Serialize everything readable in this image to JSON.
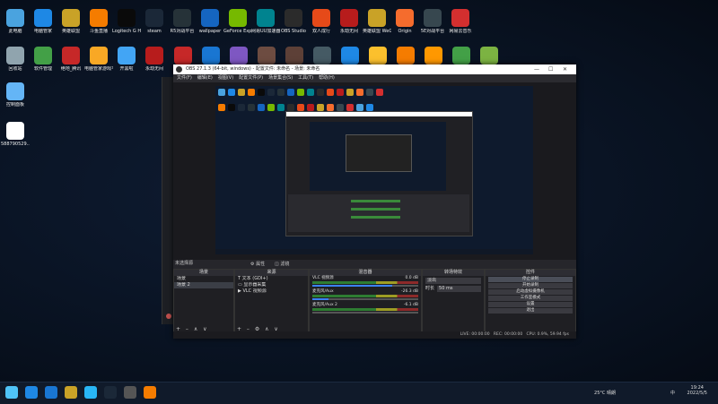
{
  "desktop": {
    "row1": [
      {
        "label": "此电脑",
        "color": "#4aa3df",
        "icon": "computer-icon"
      },
      {
        "label": "电脑管家",
        "color": "#1e88e5",
        "icon": "shield-icon"
      },
      {
        "label": "英雄联盟",
        "color": "#c9a227",
        "icon": "game-icon"
      },
      {
        "label": "斗鱼直播",
        "color": "#f57c00",
        "icon": "stream-icon"
      },
      {
        "label": "Logitech G HUB",
        "color": "#0a0a0a",
        "icon": "logitech-icon"
      },
      {
        "label": "steam",
        "color": "#1b2838",
        "icon": "steam-icon"
      },
      {
        "label": "R5对战平台",
        "color": "#263238",
        "icon": "platform-icon"
      },
      {
        "label": "wallpaper",
        "color": "#1565c0",
        "icon": "wallpaper-icon"
      },
      {
        "label": "GeForce Experience",
        "color": "#76b900",
        "icon": "nvidia-icon"
      },
      {
        "label": "网易UU加速器",
        "color": "#00838f",
        "icon": "accelerator-icon"
      },
      {
        "label": "OBS Studio",
        "color": "#2b2b2b",
        "icon": "obs-icon"
      },
      {
        "label": "双人成行",
        "color": "#e64a19",
        "icon": "game-icon"
      },
      {
        "label": "永劫无间",
        "color": "#b71c1c",
        "icon": "game-icon"
      },
      {
        "label": "英雄联盟 WeGame版",
        "color": "#c9a227",
        "icon": "game-icon"
      },
      {
        "label": "Origin",
        "color": "#f56c2d",
        "icon": "origin-icon"
      },
      {
        "label": "5E对战平台",
        "color": "#37474f",
        "icon": "platform-icon"
      },
      {
        "label": "网易云音乐",
        "color": "#d32f2f",
        "icon": "music-icon"
      }
    ],
    "row2": [
      {
        "label": "回收站",
        "color": "#90a4ae",
        "icon": "recycle-bin-icon"
      },
      {
        "label": "软件管理",
        "color": "#43a047",
        "icon": "apps-icon"
      },
      {
        "label": "绝地_腾讯",
        "color": "#c62828",
        "icon": "game-icon"
      },
      {
        "label": "电脑管家游戏平台",
        "color": "#f9a825",
        "icon": "game-icon"
      },
      {
        "label": "开黑啦",
        "color": "#42a5f5",
        "icon": "chat-icon"
      },
      {
        "label": "永劫无间",
        "color": "#b71c1c",
        "icon": "game-icon"
      }
    ],
    "row2_hidden_icons": [
      {
        "color": "#c62828"
      },
      {
        "color": "#1976d2"
      },
      {
        "color": "#7e57c2"
      },
      {
        "color": "#6d4c41"
      },
      {
        "color": "#5d4037"
      },
      {
        "color": "#455a64"
      },
      {
        "color": "#1e88e5"
      },
      {
        "color": "#fbc02d"
      },
      {
        "color": "#f57c00"
      },
      {
        "color": "#ff9800"
      },
      {
        "color": "#43a047"
      },
      {
        "color": "#7cb342"
      }
    ],
    "left_items": [
      {
        "label": "控制面板",
        "color": "#64b5f6",
        "icon": "control-panel-icon"
      },
      {
        "label": "588790529...",
        "color": "#ffffff",
        "icon": "user-icon"
      }
    ]
  },
  "obs": {
    "title": "OBS 27.1.3 (64-bit, windows) - 配置文件: 未命名 - 场景: 未命名",
    "menu": [
      "文件(F)",
      "编辑(E)",
      "视图(V)",
      "配置文件(P)",
      "场景集合(S)",
      "工具(T)",
      "帮助(H)"
    ],
    "source_none": "未选择源",
    "props_btn": "⚙ 属性",
    "filters_btn": "◫ 滤镜",
    "panels": {
      "scenes": {
        "title": "场景",
        "items": [
          "场景",
          "场景 2"
        ]
      },
      "sources": {
        "title": "来源",
        "items": [
          "文本 (GDI+)",
          "显示器采集",
          "VLC 视频源"
        ]
      },
      "mixer": {
        "title": "混音器",
        "channels": [
          {
            "name": "VLC 视频源",
            "db": "0.0 dB",
            "level": 0.75
          },
          {
            "name": "麦克风/Aux",
            "db": "-26.3 dB",
            "level": 0.15
          },
          {
            "name": "麦克风/Aux 2",
            "db": "-6.1 dB",
            "level": 0.0
          }
        ]
      },
      "transitions": {
        "title": "转场特效",
        "transition": "淡出",
        "duration_label": "时长",
        "duration": "50 ms"
      },
      "controls": {
        "title": "控件",
        "buttons": [
          "停止录制",
          "开始录制",
          "启动虚拟摄像机",
          "工作室模式",
          "设置",
          "退出"
        ]
      }
    },
    "status": {
      "live": "LIVE: 00:00:00",
      "rec": "REC: 00:00:00",
      "cpu": "CPU: 0.9%, 59.94 fps"
    }
  },
  "taskbar": {
    "icons": [
      {
        "name": "start-icon",
        "color": "#4fc3f7"
      },
      {
        "name": "edge-icon",
        "color": "#1e88e5"
      },
      {
        "name": "mail-icon",
        "color": "#1976d2"
      },
      {
        "name": "lol-icon",
        "color": "#c9a227"
      },
      {
        "name": "qq-icon",
        "color": "#29b6f6"
      },
      {
        "name": "steam-icon",
        "color": "#1b2838"
      },
      {
        "name": "obs-icon",
        "color": "#555555"
      },
      {
        "name": "douyu-icon",
        "color": "#f57c00"
      }
    ],
    "weather": "25°C 晴朗",
    "ime": "中",
    "time": "19:24",
    "date": "2022/5/5"
  }
}
